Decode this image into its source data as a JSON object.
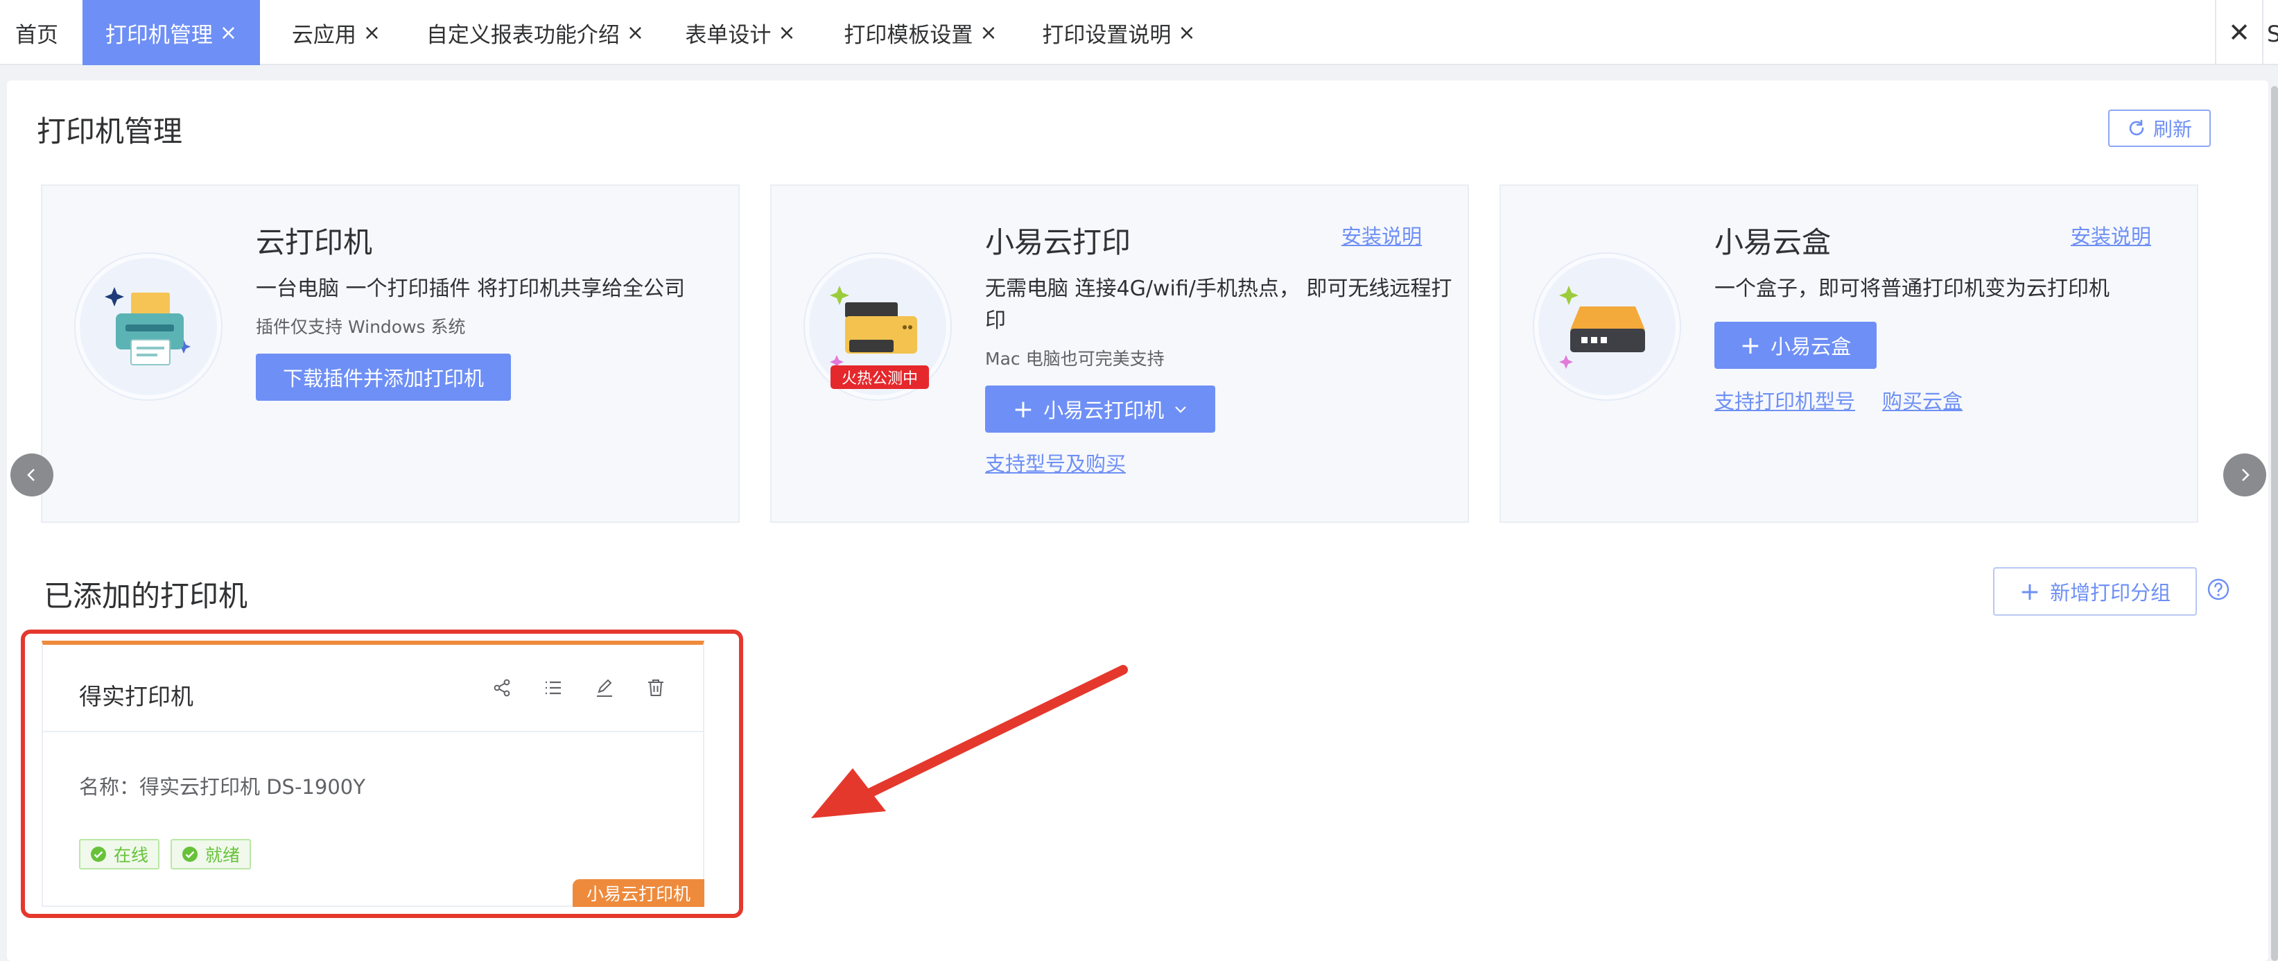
{
  "tabs": [
    {
      "label": "首页",
      "closable": false,
      "active": false
    },
    {
      "label": "打印机管理",
      "closable": true,
      "active": true
    },
    {
      "label": "云应用",
      "closable": true,
      "active": false
    },
    {
      "label": "自定义报表功能介绍",
      "closable": true,
      "active": false
    },
    {
      "label": "表单设计",
      "closable": true,
      "active": false
    },
    {
      "label": "打印模板设置",
      "closable": true,
      "active": false
    },
    {
      "label": "打印设置说明",
      "closable": true,
      "active": false
    }
  ],
  "close_glyph": "×",
  "tabbar_close_glyph": "✕",
  "tabbar_cut_glyph": "S",
  "page": {
    "title": "打印机管理",
    "refresh_label": "刷新"
  },
  "services": [
    {
      "title": "云打印机",
      "desc": "一台电脑 一个打印插件 将打印机共享给全公司",
      "note": "插件仅支持 Windows 系统",
      "button": "下载插件并添加打印机"
    },
    {
      "title": "小易云打印",
      "install_link": "安装说明",
      "desc": "无需电脑 连接4G/wifi/手机热点， 即可无线远程打印",
      "note": "Mac 电脑也可完美支持",
      "badge": "火热公测中",
      "button": "小易云打印机",
      "link": "支持型号及购买"
    },
    {
      "title": "小易云盒",
      "install_link": "安装说明",
      "desc": "一个盒子，即可将普通打印机变为云打印机",
      "button": "小易云盒",
      "link1": "支持打印机型号",
      "link2": "购买云盒"
    }
  ],
  "printers": {
    "section_title": "已添加的打印机",
    "add_group_label": "新增打印分组",
    "card": {
      "name": "得实打印机",
      "model": "名称：得实云打印机 DS-1900Y",
      "tags": [
        "在线",
        "就绪"
      ],
      "type_badge": "小易云打印机"
    }
  },
  "colors": {
    "accent": "#6e8ff5",
    "highlight": "#e5382d",
    "card_top": "#ee8a3c",
    "success": "#67c23a",
    "hot": "#e5282c"
  }
}
